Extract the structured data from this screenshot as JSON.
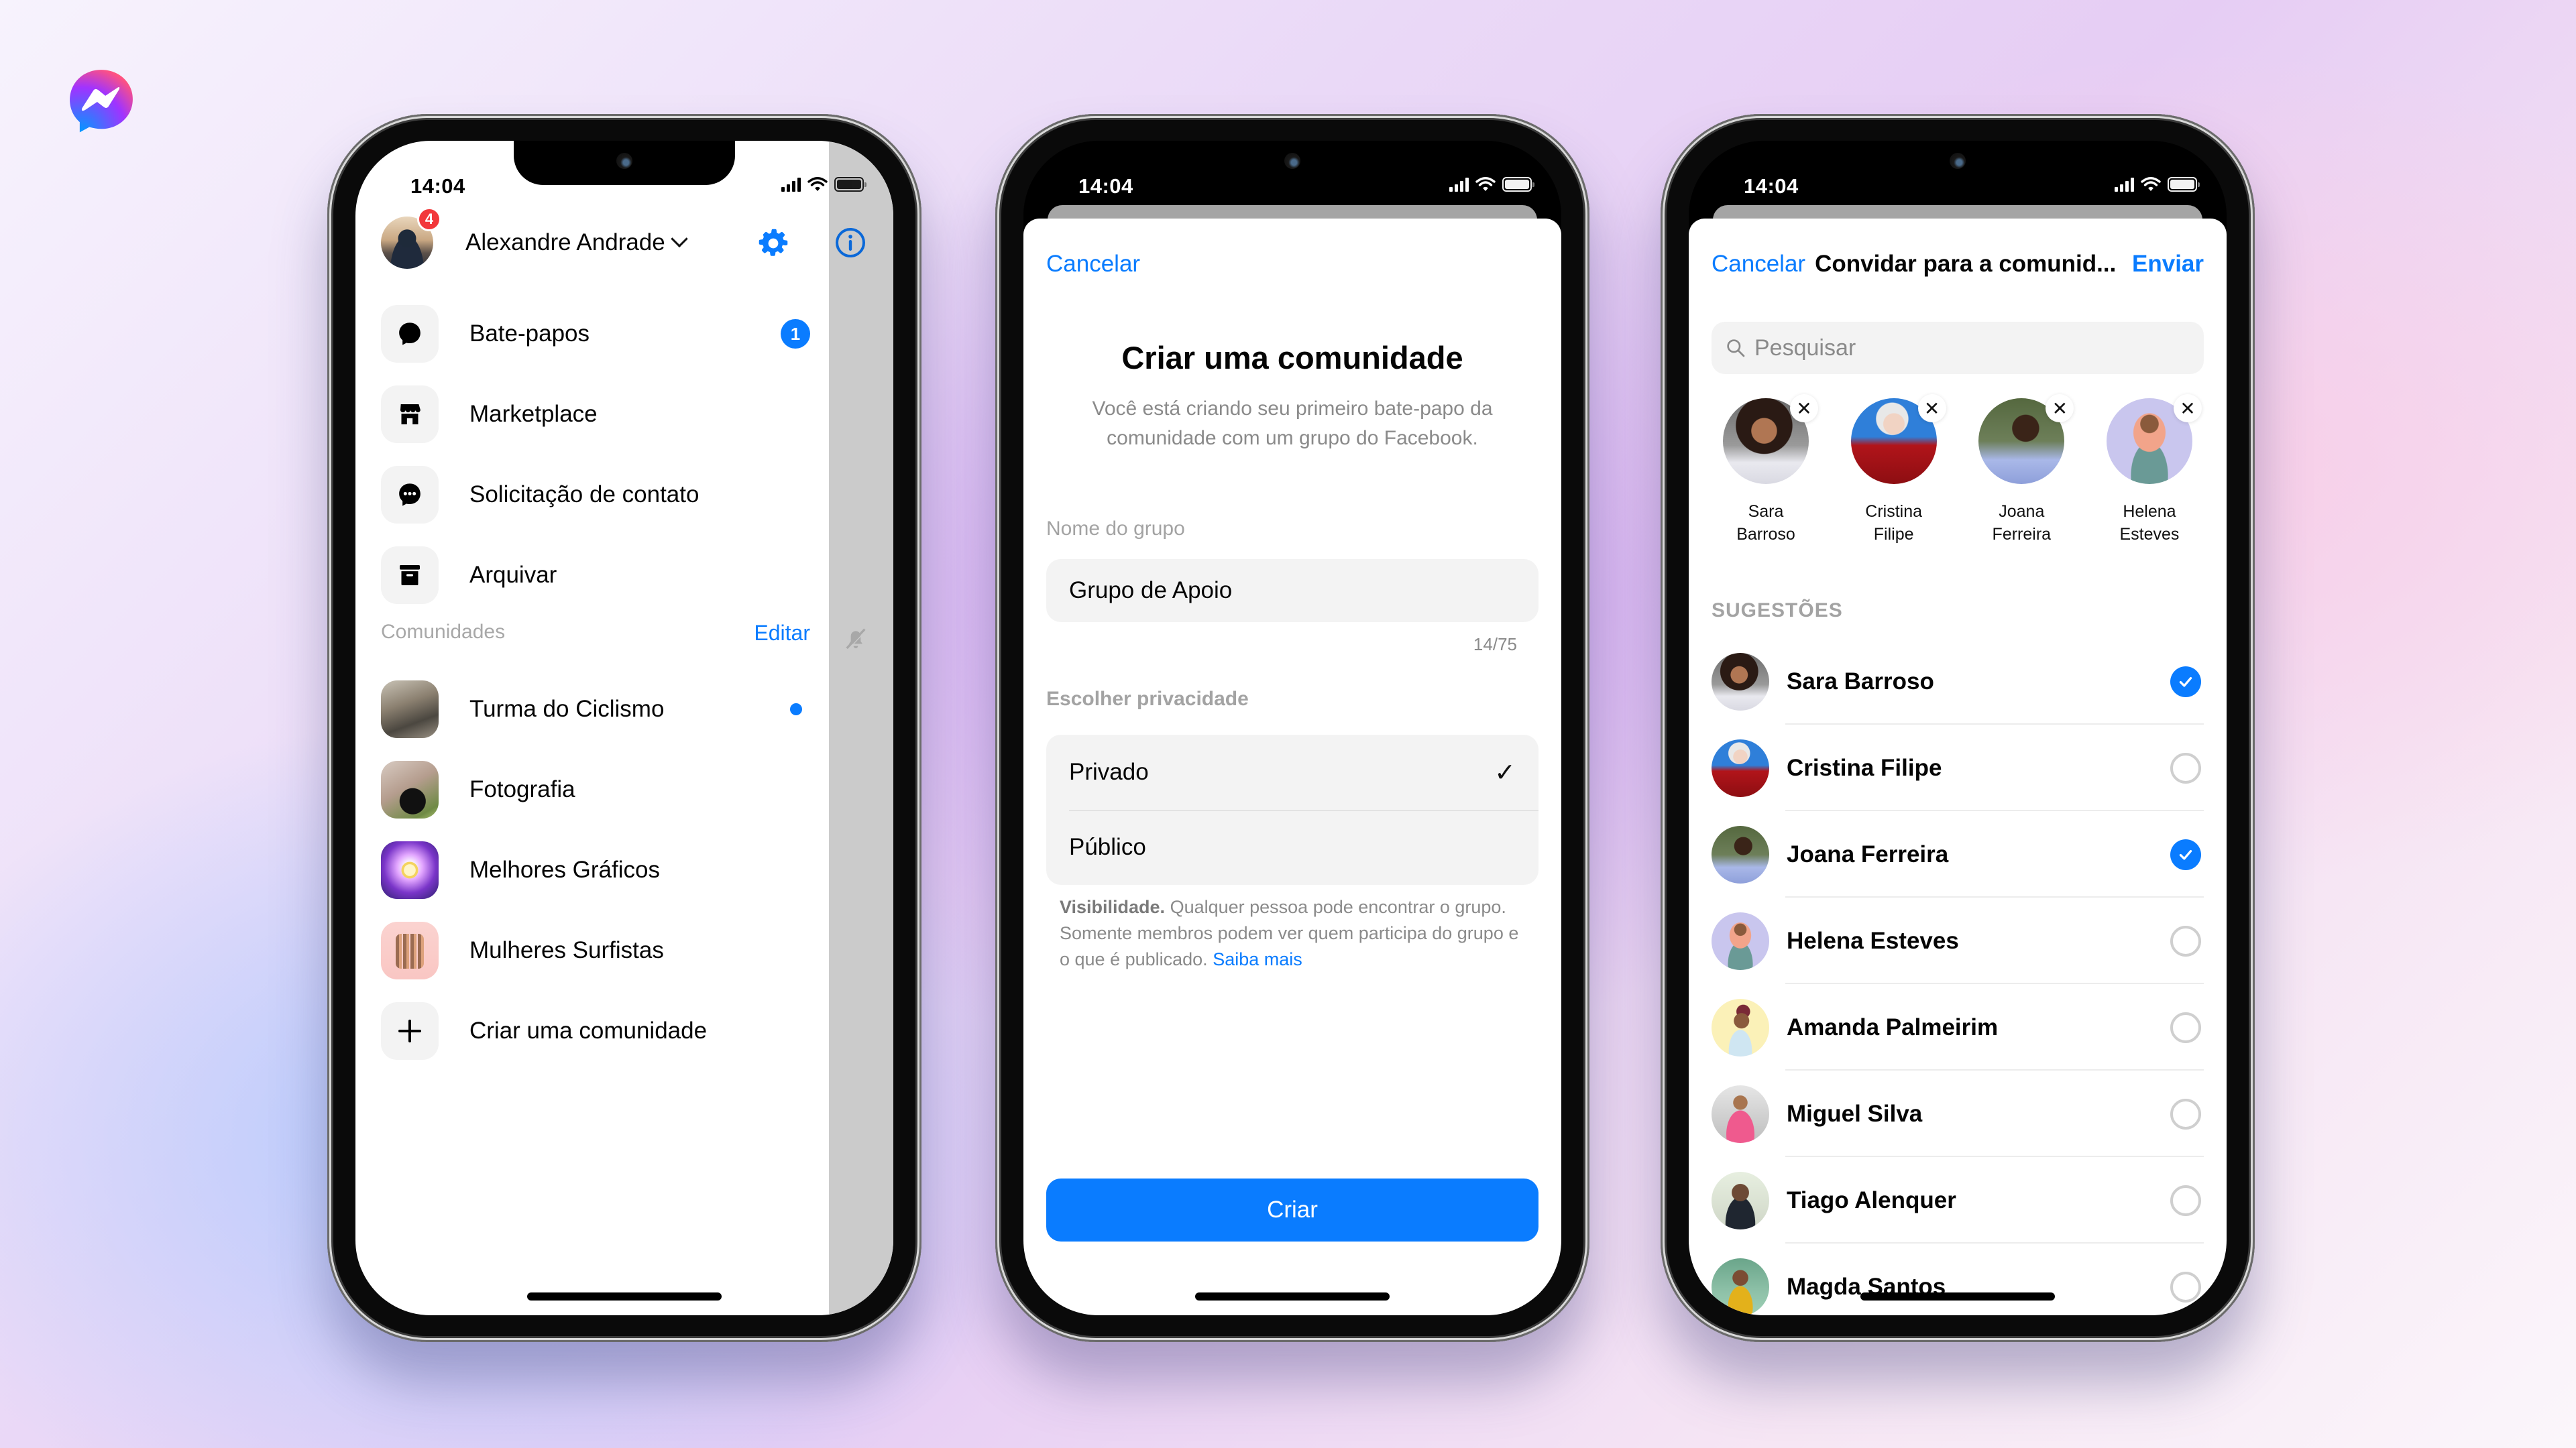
{
  "brand": {
    "logo_icon": "messenger-logo-icon",
    "accent": "#0a7cff"
  },
  "status_bar": {
    "time": "14:04",
    "icons": [
      "cellular-signal-icon",
      "wifi-icon",
      "battery-icon"
    ]
  },
  "screen1": {
    "profile": {
      "name": "Alexandre Andrade",
      "notification_count": "4",
      "dropdown_icon": "chevron-down-icon"
    },
    "header_icons": [
      "gear-icon",
      "info-icon"
    ],
    "menu": [
      {
        "label": "Bate-papos",
        "icon": "chat-bubble-icon",
        "badge": "1"
      },
      {
        "label": "Marketplace",
        "icon": "storefront-icon",
        "badge": ""
      },
      {
        "label": "Solicitação de contato",
        "icon": "chat-request-icon",
        "badge": ""
      },
      {
        "label": "Arquivar",
        "icon": "archive-box-icon",
        "badge": ""
      }
    ],
    "communities_header": "Comunidades",
    "edit_label": "Editar",
    "side_icon": "muted-bell-icon",
    "communities": [
      {
        "label": "Turma do Ciclismo",
        "unread": true
      },
      {
        "label": "Fotografia",
        "unread": false
      },
      {
        "label": "Melhores Gráficos",
        "unread": false
      },
      {
        "label": "Mulheres Surfistas",
        "unread": false
      }
    ],
    "create_label": "Criar uma comunidade"
  },
  "screen2": {
    "cancel_label": "Cancelar",
    "title": "Criar uma comunidade",
    "subtitle": "Você está criando seu primeiro bate-papo da comunidade com um grupo do Facebook.",
    "group_name_label": "Nome do grupo",
    "group_name_value": "Grupo de Apoio",
    "char_counter": "14/75",
    "privacy_label": "Escolher privacidade",
    "privacy_options": [
      {
        "label": "Privado",
        "selected": true
      },
      {
        "label": "Público",
        "selected": false
      }
    ],
    "visibility_bold": "Visibilidade.",
    "visibility_text": " Qualquer pessoa pode encontrar o grupo. Somente membros podem ver quem participa do grupo e o que é publicado. ",
    "learn_more": "Saiba mais",
    "create_button": "Criar"
  },
  "screen3": {
    "cancel_label": "Cancelar",
    "title": "Convidar para a comunid...",
    "send_label": "Enviar",
    "search_placeholder": "Pesquisar",
    "selected": [
      {
        "first": "Sara",
        "last": "Barroso"
      },
      {
        "first": "Cristina",
        "last": "Filipe"
      },
      {
        "first": "Joana",
        "last": "Ferreira"
      },
      {
        "first": "Helena",
        "last": "Esteves"
      }
    ],
    "remove_symbol": "✕",
    "suggestions_header": "SUGESTÕES",
    "suggestions": [
      {
        "name": "Sara Barroso",
        "checked": true
      },
      {
        "name": "Cristina Filipe",
        "checked": false
      },
      {
        "name": "Joana Ferreira",
        "checked": true
      },
      {
        "name": "Helena Esteves",
        "checked": false
      },
      {
        "name": "Amanda Palmeirim",
        "checked": false
      },
      {
        "name": "Miguel Silva",
        "checked": false
      },
      {
        "name": "Tiago Alenquer",
        "checked": false
      },
      {
        "name": "Magda Santos",
        "checked": false
      }
    ]
  }
}
